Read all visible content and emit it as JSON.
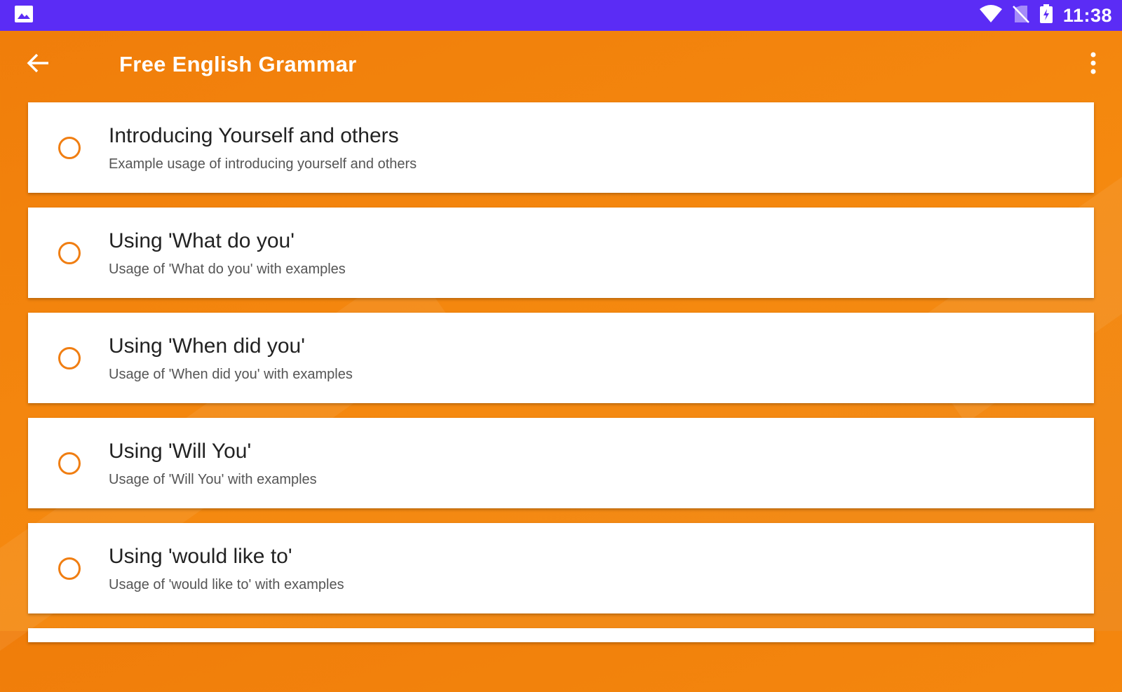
{
  "status_bar": {
    "time": "11:38",
    "left_icon": "image-icon",
    "right_icons": [
      "wifi-icon",
      "no-sim-icon",
      "battery-icon"
    ],
    "color": "#5b2cf5"
  },
  "app_bar": {
    "title": "Free English Grammar",
    "back_icon": "arrow-back-icon",
    "menu_icon": "more-vert-icon",
    "color": "#f5870f"
  },
  "lessons": [
    {
      "title": "Introducing Yourself and others",
      "subtitle": "Example usage of introducing yourself and others"
    },
    {
      "title": "Using 'What do you'",
      "subtitle": "Usage of 'What do you' with examples"
    },
    {
      "title": "Using 'When did you'",
      "subtitle": "Usage of 'When did you' with examples"
    },
    {
      "title": "Using 'Will You'",
      "subtitle": "Usage of 'Will You' with examples"
    },
    {
      "title": "Using 'would like to'",
      "subtitle": "Usage of 'would like to' with examples"
    }
  ],
  "accent_color": "#f07e12"
}
